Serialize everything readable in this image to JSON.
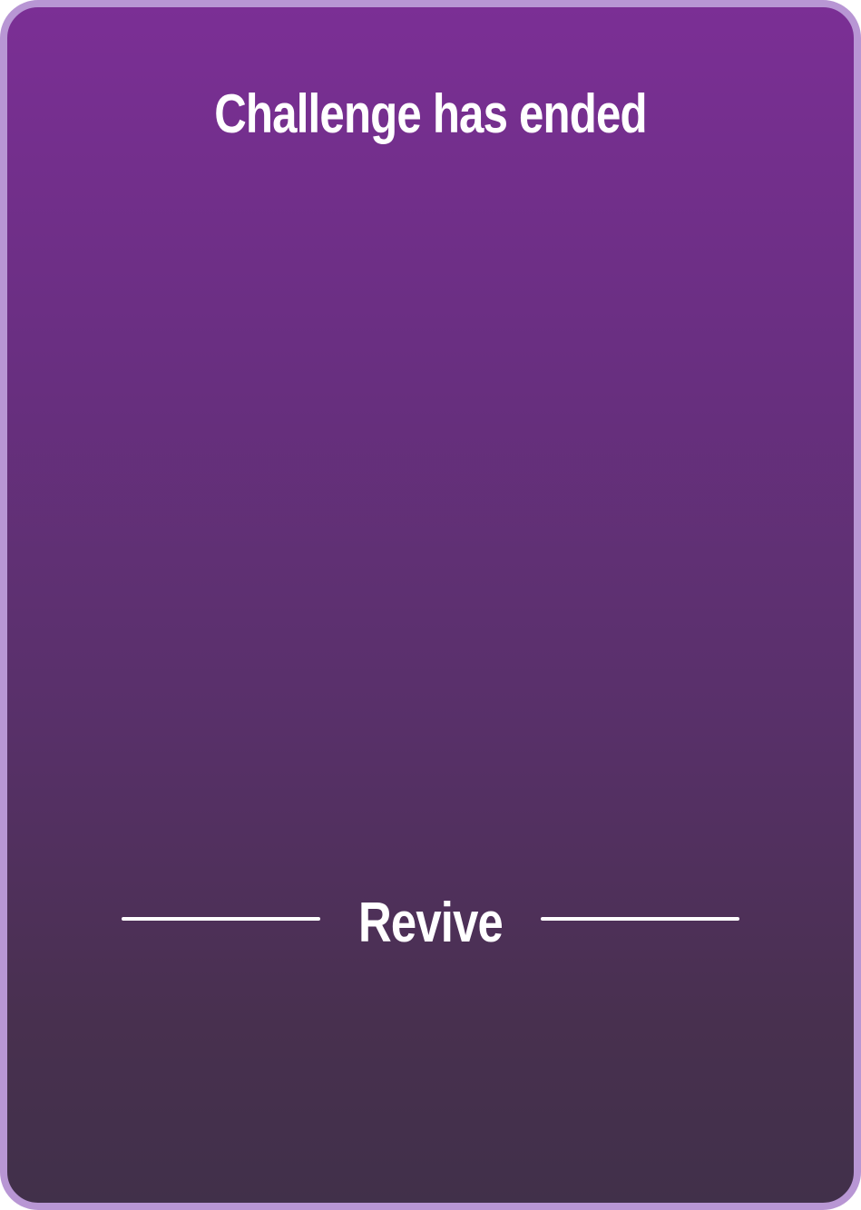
{
  "screen": {
    "title": "Challenge has ended",
    "revive_label": "Revive"
  },
  "colors": {
    "border": "#b896d4",
    "gradient_top": "#7b2f95",
    "gradient_bottom": "#41304a",
    "text": "#ffffff"
  }
}
